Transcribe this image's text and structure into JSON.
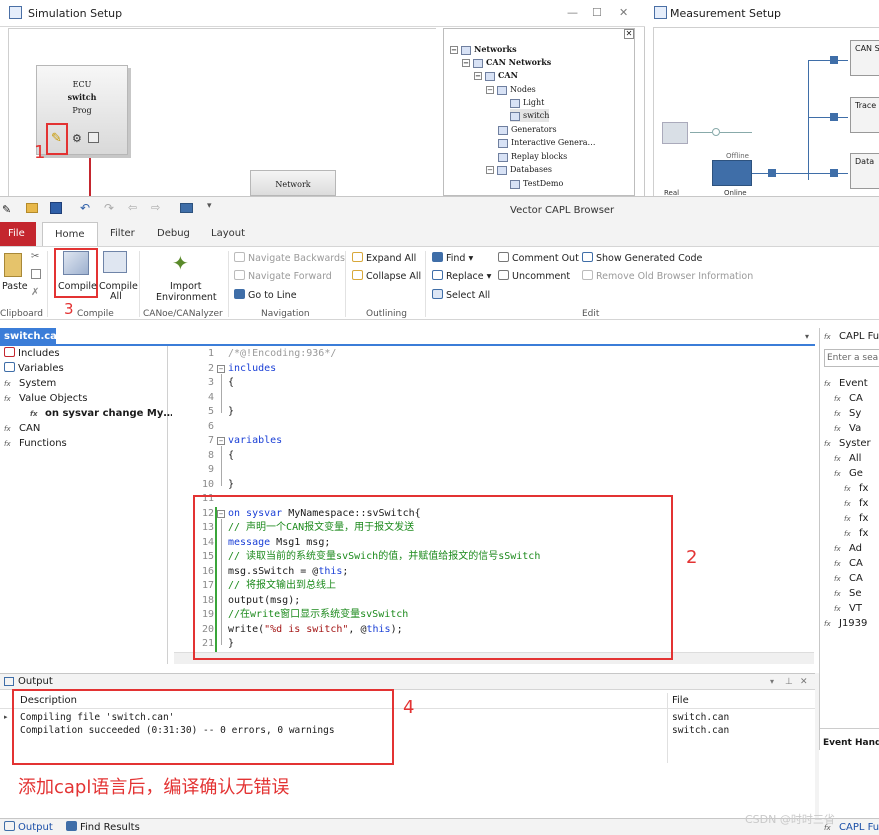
{
  "simulation_setup": {
    "title": "Simulation Setup",
    "ecu": {
      "line1": "ECU",
      "line2": "switch",
      "line3": "Prog"
    },
    "network_box": "Network",
    "tree": [
      "Networks",
      "CAN Networks",
      "CAN",
      "Nodes",
      "Light",
      "switch",
      "Generators",
      "Interactive Genera…",
      "Replay blocks",
      "Databases",
      "TestDemo"
    ]
  },
  "measurement_setup": {
    "title": "Measurement Setup",
    "node_labels": [
      "CAN S",
      "Trace",
      "Data"
    ],
    "offline_label": "Offline",
    "online_label": "Online",
    "real_label": "Real"
  },
  "capl_browser": {
    "window_title": "Vector CAPL Browser",
    "tabs": [
      "File",
      "Home",
      "Filter",
      "Debug",
      "Layout"
    ],
    "ribbon": {
      "paste": "Paste",
      "clipboard": "Clipboard",
      "compile": "Compile",
      "compile_all_1": "Compile",
      "compile_all_2": "All",
      "compile_group": "Compile",
      "import_env_1": "Import",
      "import_env_2": "Environment",
      "canoe_group": "CANoe/CANalyzer",
      "nav_back": "Navigate Backwards",
      "nav_forward": "Navigate Forward",
      "go_to_line": "Go to Line",
      "navigation_group": "Navigation",
      "expand_all": "Expand All",
      "collapse_all": "Collapse All",
      "outlining_group": "Outlining",
      "find": "Find",
      "replace": "Replace",
      "select_all": "Select All",
      "comment_out": "Comment Out",
      "uncomment": "Uncomment",
      "show_generated": "Show Generated Code",
      "remove_old": "Remove Old Browser Information",
      "edit_group": "Edit"
    },
    "file_tab": "switch.can",
    "left_tree": [
      "Includes",
      "Variables",
      "System",
      "Value Objects",
      "on sysvar change My…",
      "CAN",
      "Functions"
    ],
    "code_lines": [
      "/*@!Encoding:936*/",
      "includes",
      "{",
      "",
      "}",
      "",
      "variables",
      "{",
      "",
      "}",
      "",
      "on sysvar MyNamespace::svSwitch{",
      "// 声明一个CAN报文变量，用于报文发送",
      "message Msg1 msg;",
      "// 读取当前的系统变量svSwich的值，并赋值给报文的信号sSwitch",
      "msg.sSwitch = @this;",
      "// 将报文输出到总线上",
      "output(msg);",
      "//在write窗口显示系统变量svSwitch",
      "write(\"%d is switch\", @this);",
      "}"
    ],
    "line_numbers": [
      "1",
      "2",
      "3",
      "4",
      "5",
      "6",
      "7",
      "8",
      "9",
      "10",
      "11",
      "12",
      "13",
      "14",
      "15",
      "16",
      "17",
      "18",
      "19",
      "20",
      "21"
    ],
    "right_pane": {
      "title": "CAPL Fu",
      "search_placeholder": "Enter a sea",
      "items": [
        "Event",
        "CA",
        "Sy",
        "Va",
        "Syster",
        "All",
        "Ge",
        "fx",
        "fx",
        "fx",
        "fx",
        "Ad",
        "CA",
        "CA",
        "Se",
        "VT",
        "J1939"
      ],
      "bottom": "Event Handl"
    },
    "output": {
      "title": "Output",
      "col_description": "Description",
      "col_file": "File",
      "rows": [
        {
          "desc": "Compiling file 'switch.can'",
          "file": "switch.can"
        },
        {
          "desc": "Compilation succeeded (0:31:30) -- 0 errors, 0 warnings",
          "file": "switch.can"
        }
      ]
    },
    "bottom_tabs": [
      "Output",
      "Find Results"
    ],
    "bottom_right_tab": "CAPL Fu"
  },
  "annotations": {
    "n1": "1",
    "n2": "2",
    "n3": "3",
    "n4": "4",
    "note": "添加capl语言后，编译确认无错误",
    "watermark": "CSDN @时时三省"
  },
  "colors": {
    "accent_blue": "#3b7dd8",
    "file_tab_red": "#c4262e",
    "annotation_red": "#e33333",
    "keyword_blue": "#1a3fd6",
    "comment_green": "#1c8a1c"
  }
}
